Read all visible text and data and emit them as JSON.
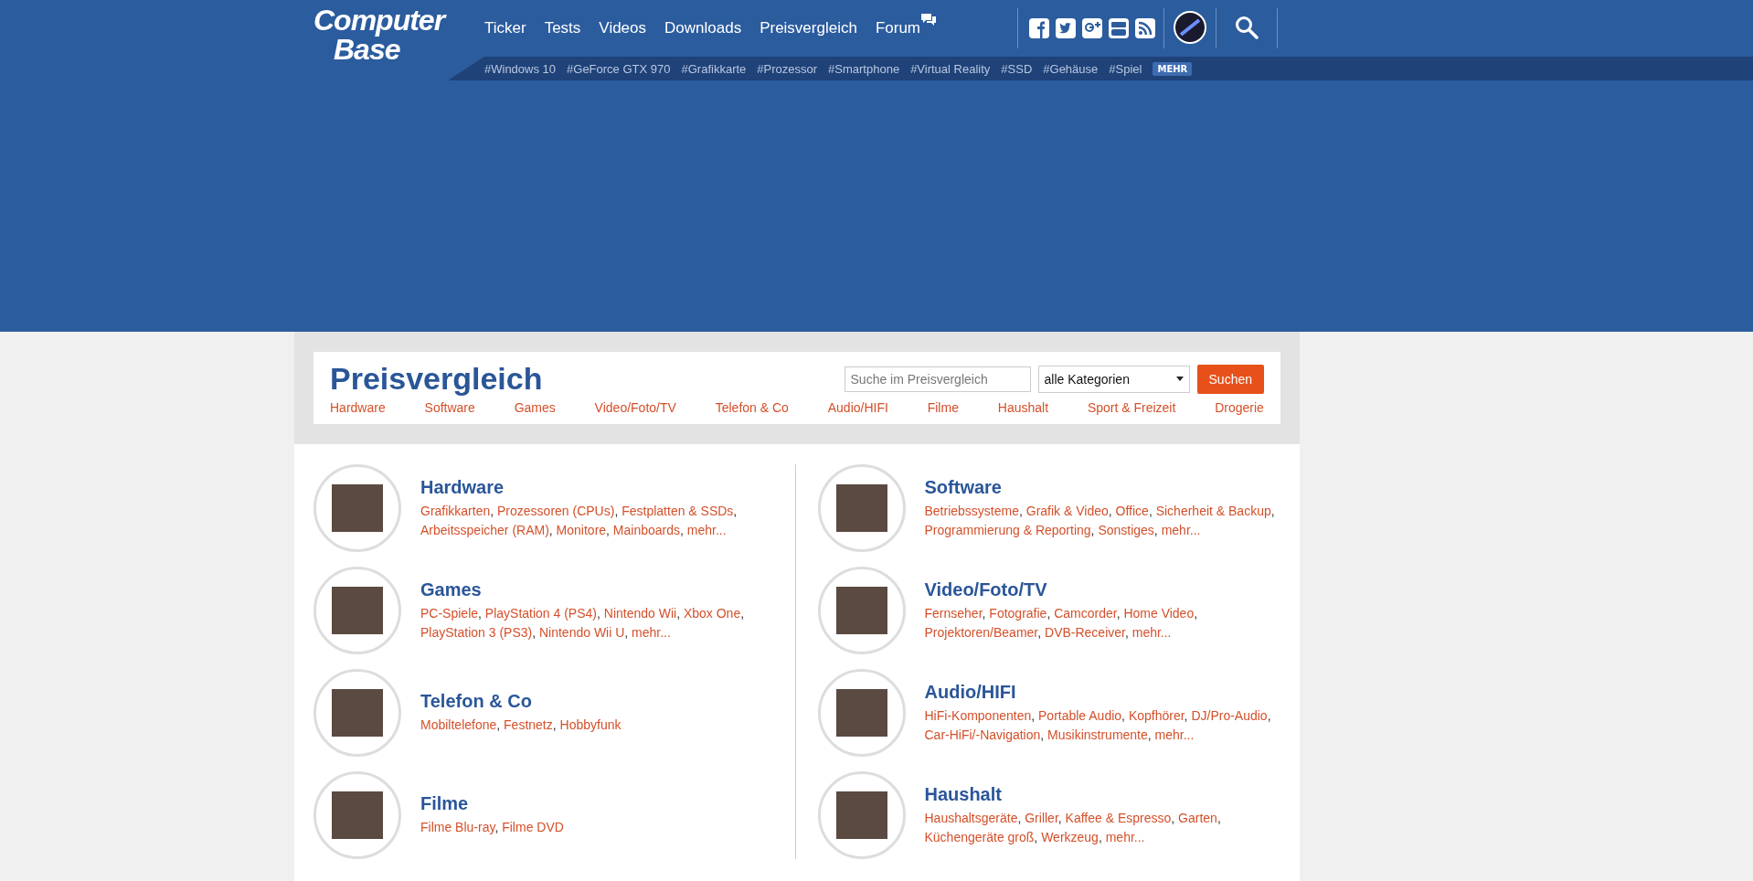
{
  "header": {
    "logo": {
      "line1": "Computer",
      "line2": "Base"
    },
    "nav": [
      {
        "label": "Ticker",
        "kind": "plain"
      },
      {
        "label": "Tests",
        "kind": "plain"
      },
      {
        "label": "Videos",
        "kind": "plain"
      },
      {
        "label": "Downloads",
        "kind": "plain"
      },
      {
        "label": "Preisvergleich",
        "kind": "plain"
      },
      {
        "label": "Forum",
        "kind": "forum"
      }
    ],
    "tags": [
      "#Windows 10",
      "#GeForce GTX 970",
      "#Grafikkarte",
      "#Prozessor",
      "#Smartphone",
      "#Virtual Reality",
      "#SSD",
      "#Gehäuse",
      "#Spiel"
    ],
    "more_tags": "MEHR"
  },
  "price_compare": {
    "title": "Preisvergleich",
    "search": {
      "placeholder": "Suche im Preisvergleich"
    },
    "category_select": "alle Kategorien",
    "button": "Suchen",
    "tabs": [
      "Hardware",
      "Software",
      "Games",
      "Video/Foto/TV",
      "Telefon & Co",
      "Audio/HIFI",
      "Filme",
      "Haushalt",
      "Sport & Freizeit",
      "Drogerie"
    ]
  },
  "separator": ", ",
  "columns": [
    [
      {
        "title": "Hardware",
        "links": [
          "Grafikkarten",
          "Prozessoren (CPUs)",
          "Festplatten & SSDs",
          "Arbeitsspeicher (RAM)",
          "Monitore",
          "Mainboards",
          "mehr..."
        ]
      },
      {
        "title": "Games",
        "links": [
          "PC-Spiele",
          "PlayStation 4 (PS4)",
          "Nintendo Wii",
          "Xbox One",
          "PlayStation 3 (PS3)",
          "Nintendo Wii U",
          "mehr..."
        ]
      },
      {
        "title": "Telefon & Co",
        "links": [
          "Mobiltelefone",
          "Festnetz",
          "Hobbyfunk"
        ]
      },
      {
        "title": "Filme",
        "links": [
          "Filme Blu-ray",
          "Filme DVD"
        ]
      }
    ],
    [
      {
        "title": "Software",
        "links": [
          "Betriebssysteme",
          "Grafik & Video",
          "Office",
          "Sicherheit & Backup",
          "Programmierung & Reporting",
          "Sonstiges",
          "mehr..."
        ]
      },
      {
        "title": "Video/Foto/TV",
        "links": [
          "Fernseher",
          "Fotografie",
          "Camcorder",
          "Home Video",
          "Projektoren/Beamer",
          "DVB-Receiver",
          "mehr..."
        ]
      },
      {
        "title": "Audio/HIFI",
        "links": [
          "HiFi-Komponenten",
          "Portable Audio",
          "Kopfhörer",
          "DJ/Pro-Audio",
          "Car-HiFi/-Navigation",
          "Musikinstrumente",
          "mehr..."
        ]
      },
      {
        "title": "Haushalt",
        "links": [
          "Haushaltsgeräte",
          "Griller",
          "Kaffee & Espresso",
          "Garten",
          "Küchengeräte groß",
          "Werkzeug",
          "mehr..."
        ]
      }
    ]
  ]
}
